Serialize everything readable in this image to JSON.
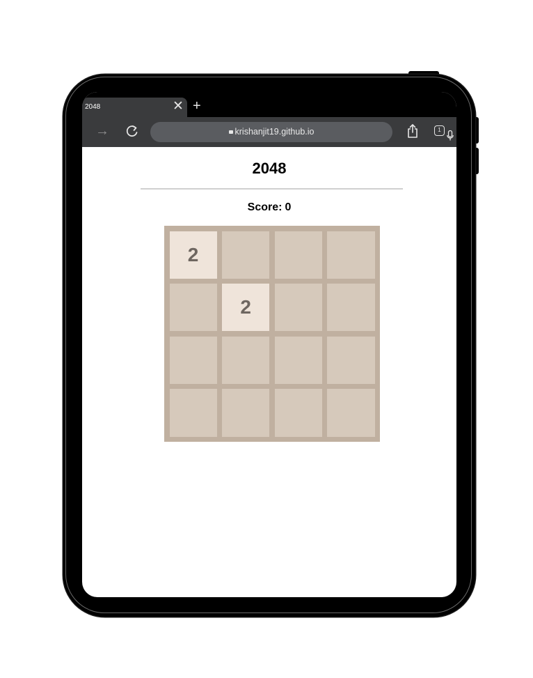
{
  "browser": {
    "tab_title": "2048",
    "tab_close": "✕",
    "new_tab": "+",
    "forward_glyph": "→",
    "url": "krishanjit19.github.io",
    "tabs_count": "1"
  },
  "page": {
    "title": "2048",
    "score_label": "Score:",
    "score_value": "0"
  },
  "board": {
    "size": 4,
    "tiles": [
      [
        "2",
        "",
        "",
        ""
      ],
      [
        "",
        "2",
        "",
        ""
      ],
      [
        "",
        "",
        "",
        ""
      ],
      [
        "",
        "",
        "",
        ""
      ]
    ]
  },
  "colors": {
    "board_bg": "#c0b0a0",
    "empty_cell": "#d6c9bb",
    "tile_2": "#efe4da",
    "tile_text": "#6e6660",
    "chrome_bg": "#3a3b3d"
  },
  "icons": {
    "forward": "arrow-right-icon",
    "reload": "reload-icon",
    "lock": "lock-icon",
    "mic": "microphone-icon",
    "share": "share-icon",
    "tabs": "tabs-icon",
    "close": "close-icon",
    "plus": "plus-icon"
  }
}
